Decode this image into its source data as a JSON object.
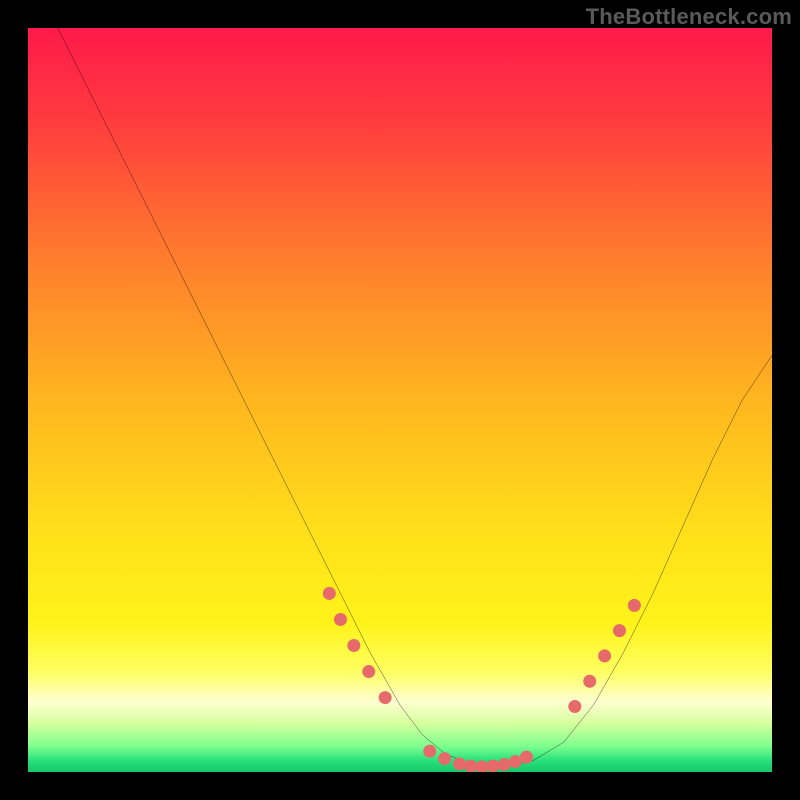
{
  "watermark": "TheBottleneck.com",
  "gradient_stops": [
    {
      "offset": 0.0,
      "color": "#ff1a4b"
    },
    {
      "offset": 0.12,
      "color": "#ff3a3f"
    },
    {
      "offset": 0.3,
      "color": "#ff7a2e"
    },
    {
      "offset": 0.5,
      "color": "#ffb61f"
    },
    {
      "offset": 0.68,
      "color": "#ffe01a"
    },
    {
      "offset": 0.8,
      "color": "#fff31a"
    },
    {
      "offset": 0.865,
      "color": "#ffff60"
    },
    {
      "offset": 0.905,
      "color": "#ffffd0"
    },
    {
      "offset": 0.935,
      "color": "#d6ff9e"
    },
    {
      "offset": 0.965,
      "color": "#7fff8f"
    },
    {
      "offset": 0.985,
      "color": "#26e07a"
    },
    {
      "offset": 1.0,
      "color": "#18c76a"
    }
  ],
  "chart_data": {
    "type": "line",
    "title": "",
    "xlabel": "",
    "ylabel": "",
    "xlim": [
      0,
      100
    ],
    "ylim": [
      0,
      100
    ],
    "grid": false,
    "legend": false,
    "series": [
      {
        "name": "curve",
        "x": [
          4,
          10,
          16,
          22,
          28,
          34,
          38,
          42,
          46,
          50,
          53,
          56,
          59,
          62,
          65,
          68,
          72,
          76,
          80,
          84,
          88,
          92,
          96,
          100
        ],
        "y": [
          100,
          88,
          76,
          64,
          52,
          40,
          32,
          24,
          16,
          9,
          5,
          2.5,
          1.2,
          0.7,
          0.8,
          1.6,
          4,
          9,
          16,
          24,
          33,
          42,
          50,
          56
        ],
        "color": "#000000"
      }
    ],
    "markers": [
      {
        "name": "left-cluster",
        "x": [
          40.5,
          42.0,
          43.8,
          45.8,
          48.0
        ],
        "y": [
          24.0,
          20.5,
          17.0,
          13.5,
          10.0
        ]
      },
      {
        "name": "bottom-cluster",
        "x": [
          54.0,
          56.0,
          58.0,
          59.5,
          61.0,
          62.5,
          64.0,
          65.5,
          67.0
        ],
        "y": [
          2.8,
          1.8,
          1.1,
          0.8,
          0.7,
          0.8,
          1.0,
          1.4,
          2.0
        ]
      },
      {
        "name": "right-cluster",
        "x": [
          73.5,
          75.5,
          77.5,
          79.5,
          81.5
        ],
        "y": [
          8.8,
          12.2,
          15.6,
          19.0,
          22.4
        ]
      }
    ],
    "marker_color": "#e66a6a",
    "marker_radius_px": 6.5
  }
}
